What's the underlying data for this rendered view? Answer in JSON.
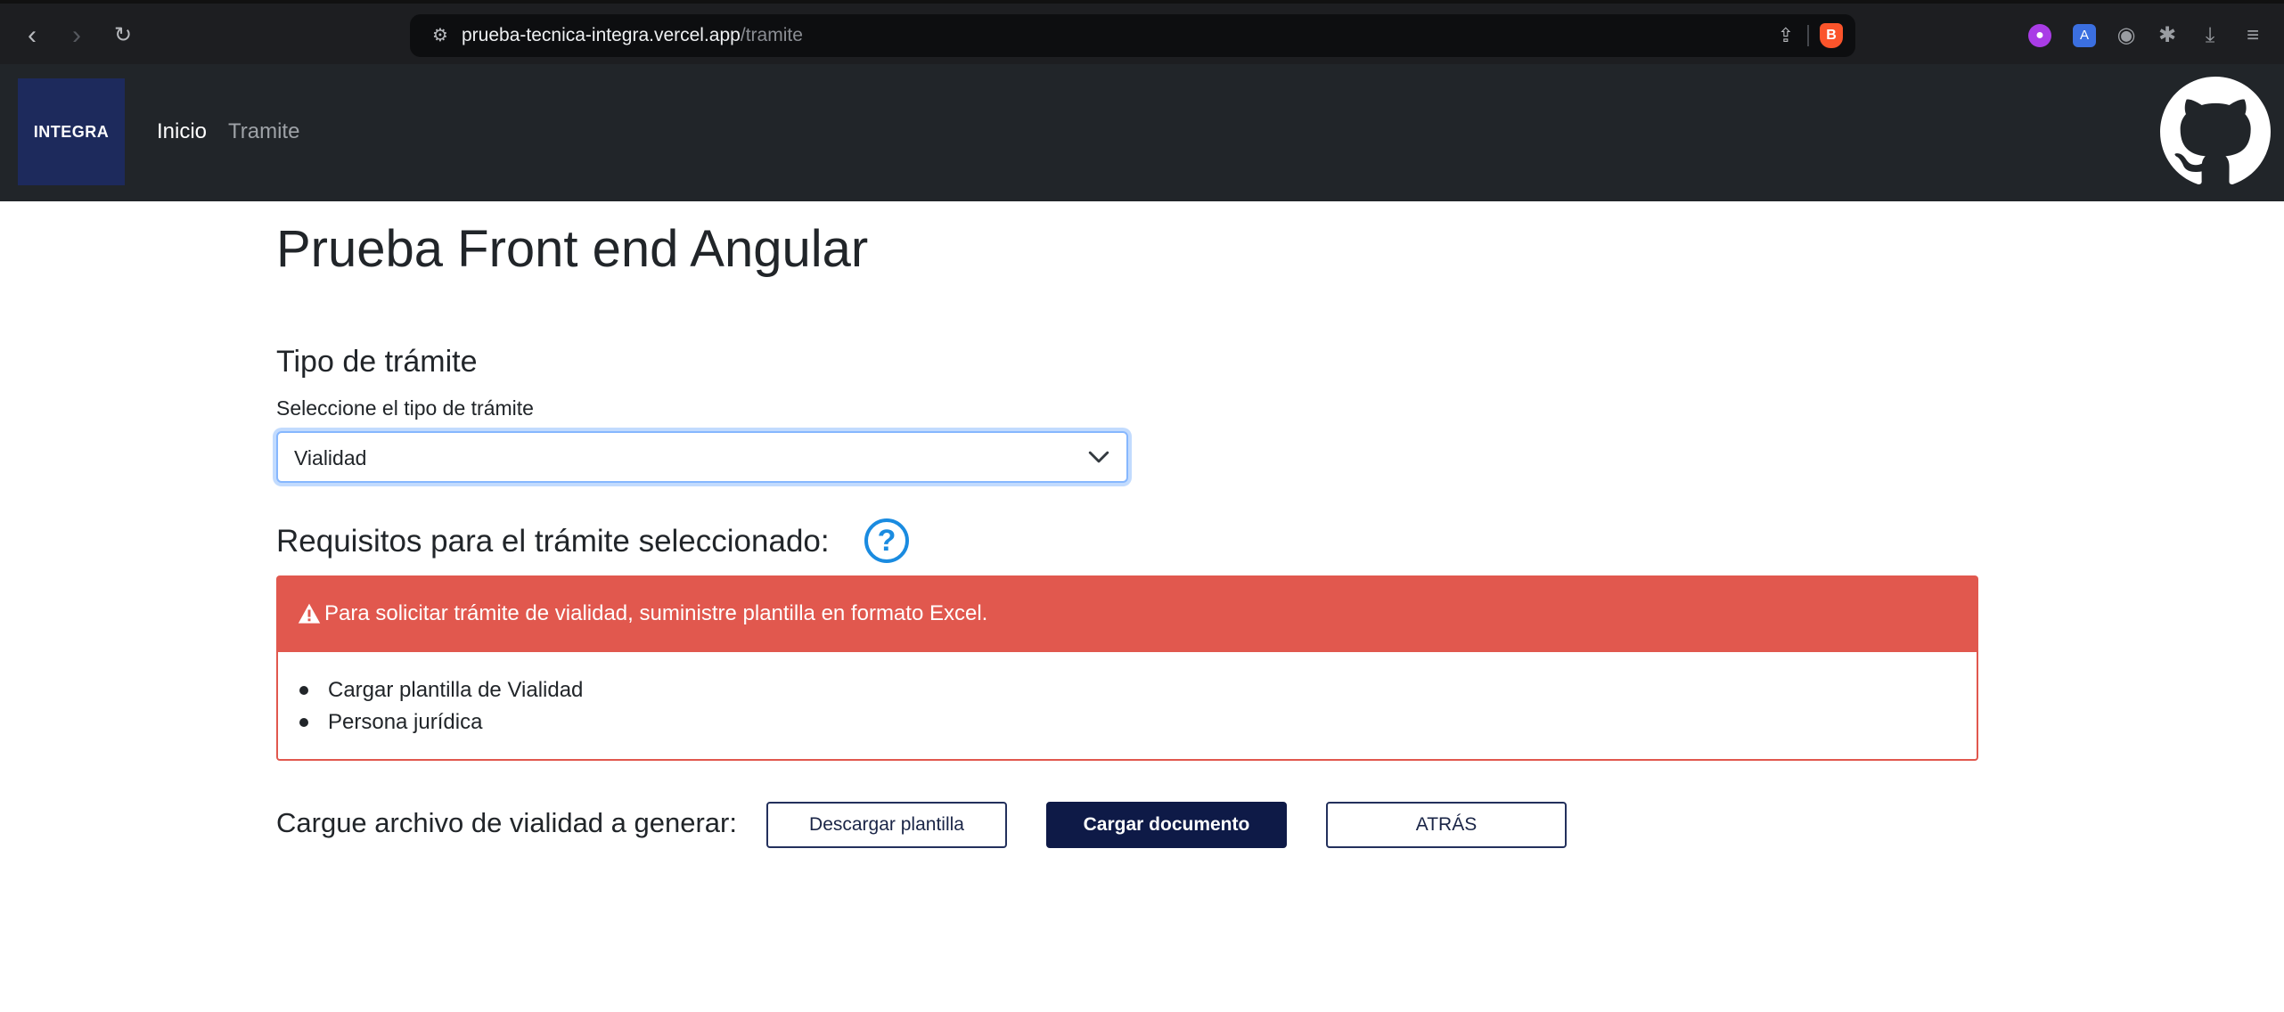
{
  "browser": {
    "url_host": "prueba-tecnica-integra.vercel.app",
    "url_path": "/tramite",
    "back_icon": "chevron-left-icon",
    "forward_icon": "chevron-right-icon",
    "reload_icon": "reload-icon"
  },
  "navbar": {
    "logo_text": "INTEGRA",
    "links": [
      {
        "label": "Inicio",
        "active": true
      },
      {
        "label": "Tramite",
        "active": false
      }
    ],
    "github_icon": "github-icon"
  },
  "main": {
    "page_title": "Prueba Front end Angular",
    "section_title": "Tipo de trámite",
    "select_label": "Seleccione el tipo de trámite",
    "select_value": "Vialidad",
    "requirements_title": "Requisitos para el trámite seleccionado:",
    "help_icon_glyph": "?",
    "alert": {
      "text": "Para solicitar trámite de vialidad, suministre plantilla en formato Excel.",
      "color": "#e1584e"
    },
    "requirements": [
      "Cargar plantilla de Vialidad",
      "Persona jurídica"
    ],
    "upload_label": "Cargue archivo de vialidad a generar:",
    "buttons": {
      "download": "Descargar plantilla",
      "upload": "Cargar documento",
      "back": "ATRÁS"
    }
  },
  "colors": {
    "navbar_bg": "#212529",
    "logo_bg": "#1d2a5c",
    "primary_button": "#0e1a47",
    "help_icon": "#1a8be0"
  }
}
